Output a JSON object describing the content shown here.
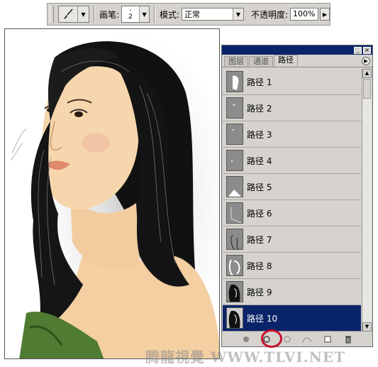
{
  "options_bar": {
    "brush_label": "画笔:",
    "brush_size": "2",
    "mode_label": "模式:",
    "mode_value": "正常",
    "opacity_label": "不透明度:",
    "opacity_value": "100%"
  },
  "panel": {
    "tabs": [
      {
        "label": "图层",
        "active": false
      },
      {
        "label": "通道",
        "active": false
      },
      {
        "label": "路径",
        "active": true
      }
    ],
    "paths": [
      {
        "label": "路径 1",
        "selected": false
      },
      {
        "label": "路径 2",
        "selected": false
      },
      {
        "label": "路径 3",
        "selected": false
      },
      {
        "label": "路径 4",
        "selected": false
      },
      {
        "label": "路径 5",
        "selected": false
      },
      {
        "label": "路径 6",
        "selected": false
      },
      {
        "label": "路径 7",
        "selected": false
      },
      {
        "label": "路径 8",
        "selected": false
      },
      {
        "label": "路径 9",
        "selected": false
      },
      {
        "label": "路径 10",
        "selected": true
      }
    ],
    "footer_icons": [
      "fill-path-icon",
      "stroke-path-icon",
      "load-selection-icon",
      "make-work-path-icon",
      "new-path-icon",
      "delete-path-icon"
    ],
    "highlighted_footer_icon": "stroke-path-icon"
  },
  "watermark": "腾龍視覺  WWW.TLVI.NET",
  "colors": {
    "selection": "#0a246a",
    "panel_bg": "#d6d3ce",
    "highlight_ring": "#c8102e"
  }
}
